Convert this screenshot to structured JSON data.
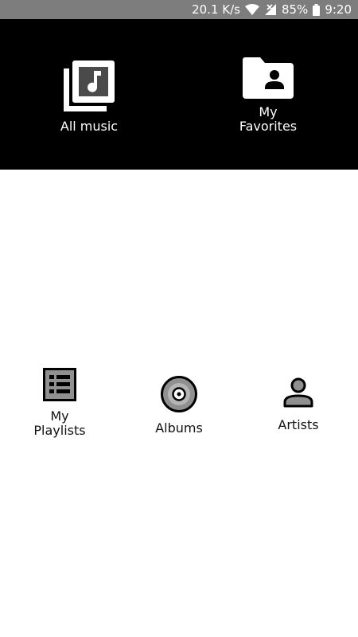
{
  "status_bar": {
    "network_speed": "20.1 K/s",
    "battery": "85%",
    "time": "9:20",
    "icons": [
      "wifi-icon",
      "no-signal-icon",
      "battery-icon"
    ]
  },
  "top_tiles": [
    {
      "label": "All music",
      "icon": "music-library-icon"
    },
    {
      "label": "My\nFavorites",
      "icon": "favorites-folder-icon"
    }
  ],
  "bottom_tiles": [
    {
      "label": "My\nPlaylists",
      "icon": "playlist-icon"
    },
    {
      "label": "Albums",
      "icon": "album-disc-icon"
    },
    {
      "label": "Artists",
      "icon": "artist-person-icon"
    }
  ],
  "colors": {
    "status_bar_bg": "#7d7d7d",
    "top_panel_bg": "#000000",
    "page_bg": "#ffffff",
    "icon_gray": "#909090"
  }
}
